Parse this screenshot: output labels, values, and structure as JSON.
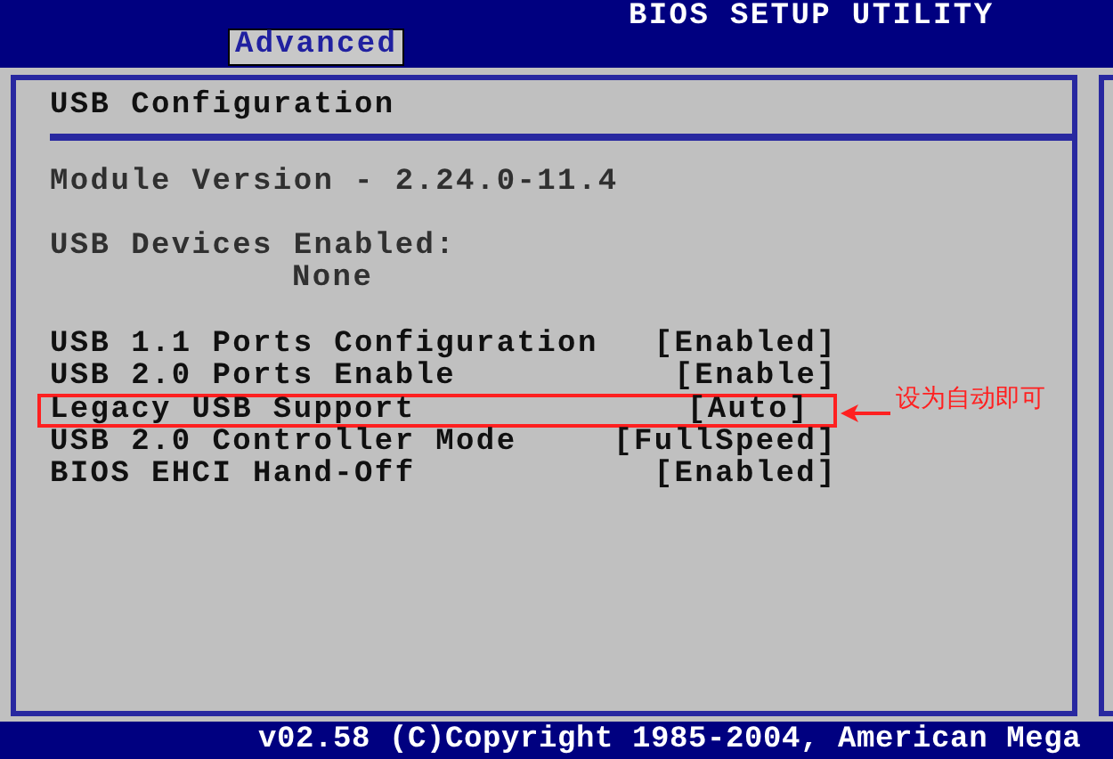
{
  "top_bar": {
    "tabs": [
      {
        "label": "Advanced",
        "selected": true
      }
    ],
    "title": "BIOS SETUP UTILITY"
  },
  "panel": {
    "heading": "USB Configuration",
    "module_version": "Module Version - 2.24.0-11.4",
    "devices_label": "USB Devices Enabled:",
    "devices_value": "None",
    "settings": [
      {
        "label": "USB 1.1 Ports Configuration",
        "value": "[Enabled]",
        "highlighted": false
      },
      {
        "label": "USB 2.0 Ports Enable",
        "value": "[Enable]",
        "highlighted": false
      },
      {
        "label": "Legacy USB Support",
        "value": "[Auto]",
        "highlighted": true
      },
      {
        "label": "USB 2.0 Controller Mode",
        "value": "[FullSpeed]",
        "highlighted": false
      },
      {
        "label": "BIOS EHCI Hand-Off",
        "value": "[Enabled]",
        "highlighted": false
      }
    ]
  },
  "annotation": {
    "text": "设为自动即可"
  },
  "footer": "v02.58 (C)Copyright 1985-2004, American Mega"
}
